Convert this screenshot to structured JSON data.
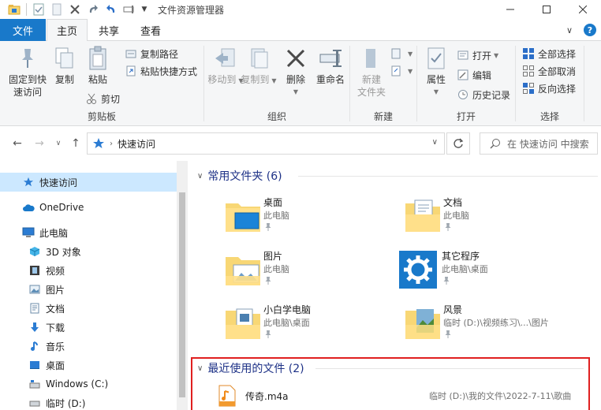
{
  "window": {
    "title": "文件资源管理器"
  },
  "ribbon_tabs": {
    "file": "文件",
    "home": "主页",
    "share": "共享",
    "view": "查看"
  },
  "clipboard": {
    "pin": "固定到快速访问",
    "pin_l1": "固定到快",
    "pin_l2": "速访问",
    "copy": "复制",
    "paste": "粘贴",
    "copy_path": "复制路径",
    "paste_shortcut": "粘贴快捷方式",
    "cut": "剪切",
    "label": "剪贴板"
  },
  "organize": {
    "move_to": "移动到",
    "copy_to": "复制到",
    "delete": "删除",
    "rename": "重命名",
    "label": "组织"
  },
  "new": {
    "new_folder_l1": "新建",
    "new_folder_l2": "文件夹",
    "label": "新建"
  },
  "open": {
    "properties": "属性",
    "open": "打开",
    "edit": "编辑",
    "history": "历史记录",
    "label": "打开"
  },
  "select": {
    "select_all": "全部选择",
    "select_none": "全部取消",
    "invert": "反向选择",
    "label": "选择"
  },
  "address": {
    "path": "快速访问",
    "search_placeholder": "在 快速访问 中搜索"
  },
  "nav": {
    "quick_access": "快速访问",
    "onedrive": "OneDrive",
    "this_pc": "此电脑",
    "objects3d": "3D 对象",
    "videos": "视频",
    "pictures": "图片",
    "documents": "文档",
    "downloads": "下载",
    "music": "音乐",
    "desktop": "桌面",
    "drive_c": "Windows (C:)",
    "drive_d": "临时 (D:)"
  },
  "frequent": {
    "header": "常用文件夹 (6)",
    "items": [
      {
        "name": "桌面",
        "sub": "此电脑"
      },
      {
        "name": "文档",
        "sub": "此电脑"
      },
      {
        "name": "图片",
        "sub": "此电脑"
      },
      {
        "name": "其它程序",
        "sub": "此电脑\\桌面"
      },
      {
        "name": "小白学电脑",
        "sub": "此电脑\\桌面"
      },
      {
        "name": "风景",
        "sub": "临时 (D:)\\视频练习\\...\\图片"
      }
    ]
  },
  "recent": {
    "header": "最近使用的文件 (2)",
    "items": [
      {
        "name": "传奇.m4a",
        "path": "临时 (D:)\\我的文件\\2022-7-11\\歌曲"
      }
    ]
  },
  "colors": {
    "accent": "#1979ca",
    "selected": "#cce8ff",
    "header_text": "#1e3287",
    "highlight_box": "#e02020",
    "folder": "#f8d775"
  }
}
